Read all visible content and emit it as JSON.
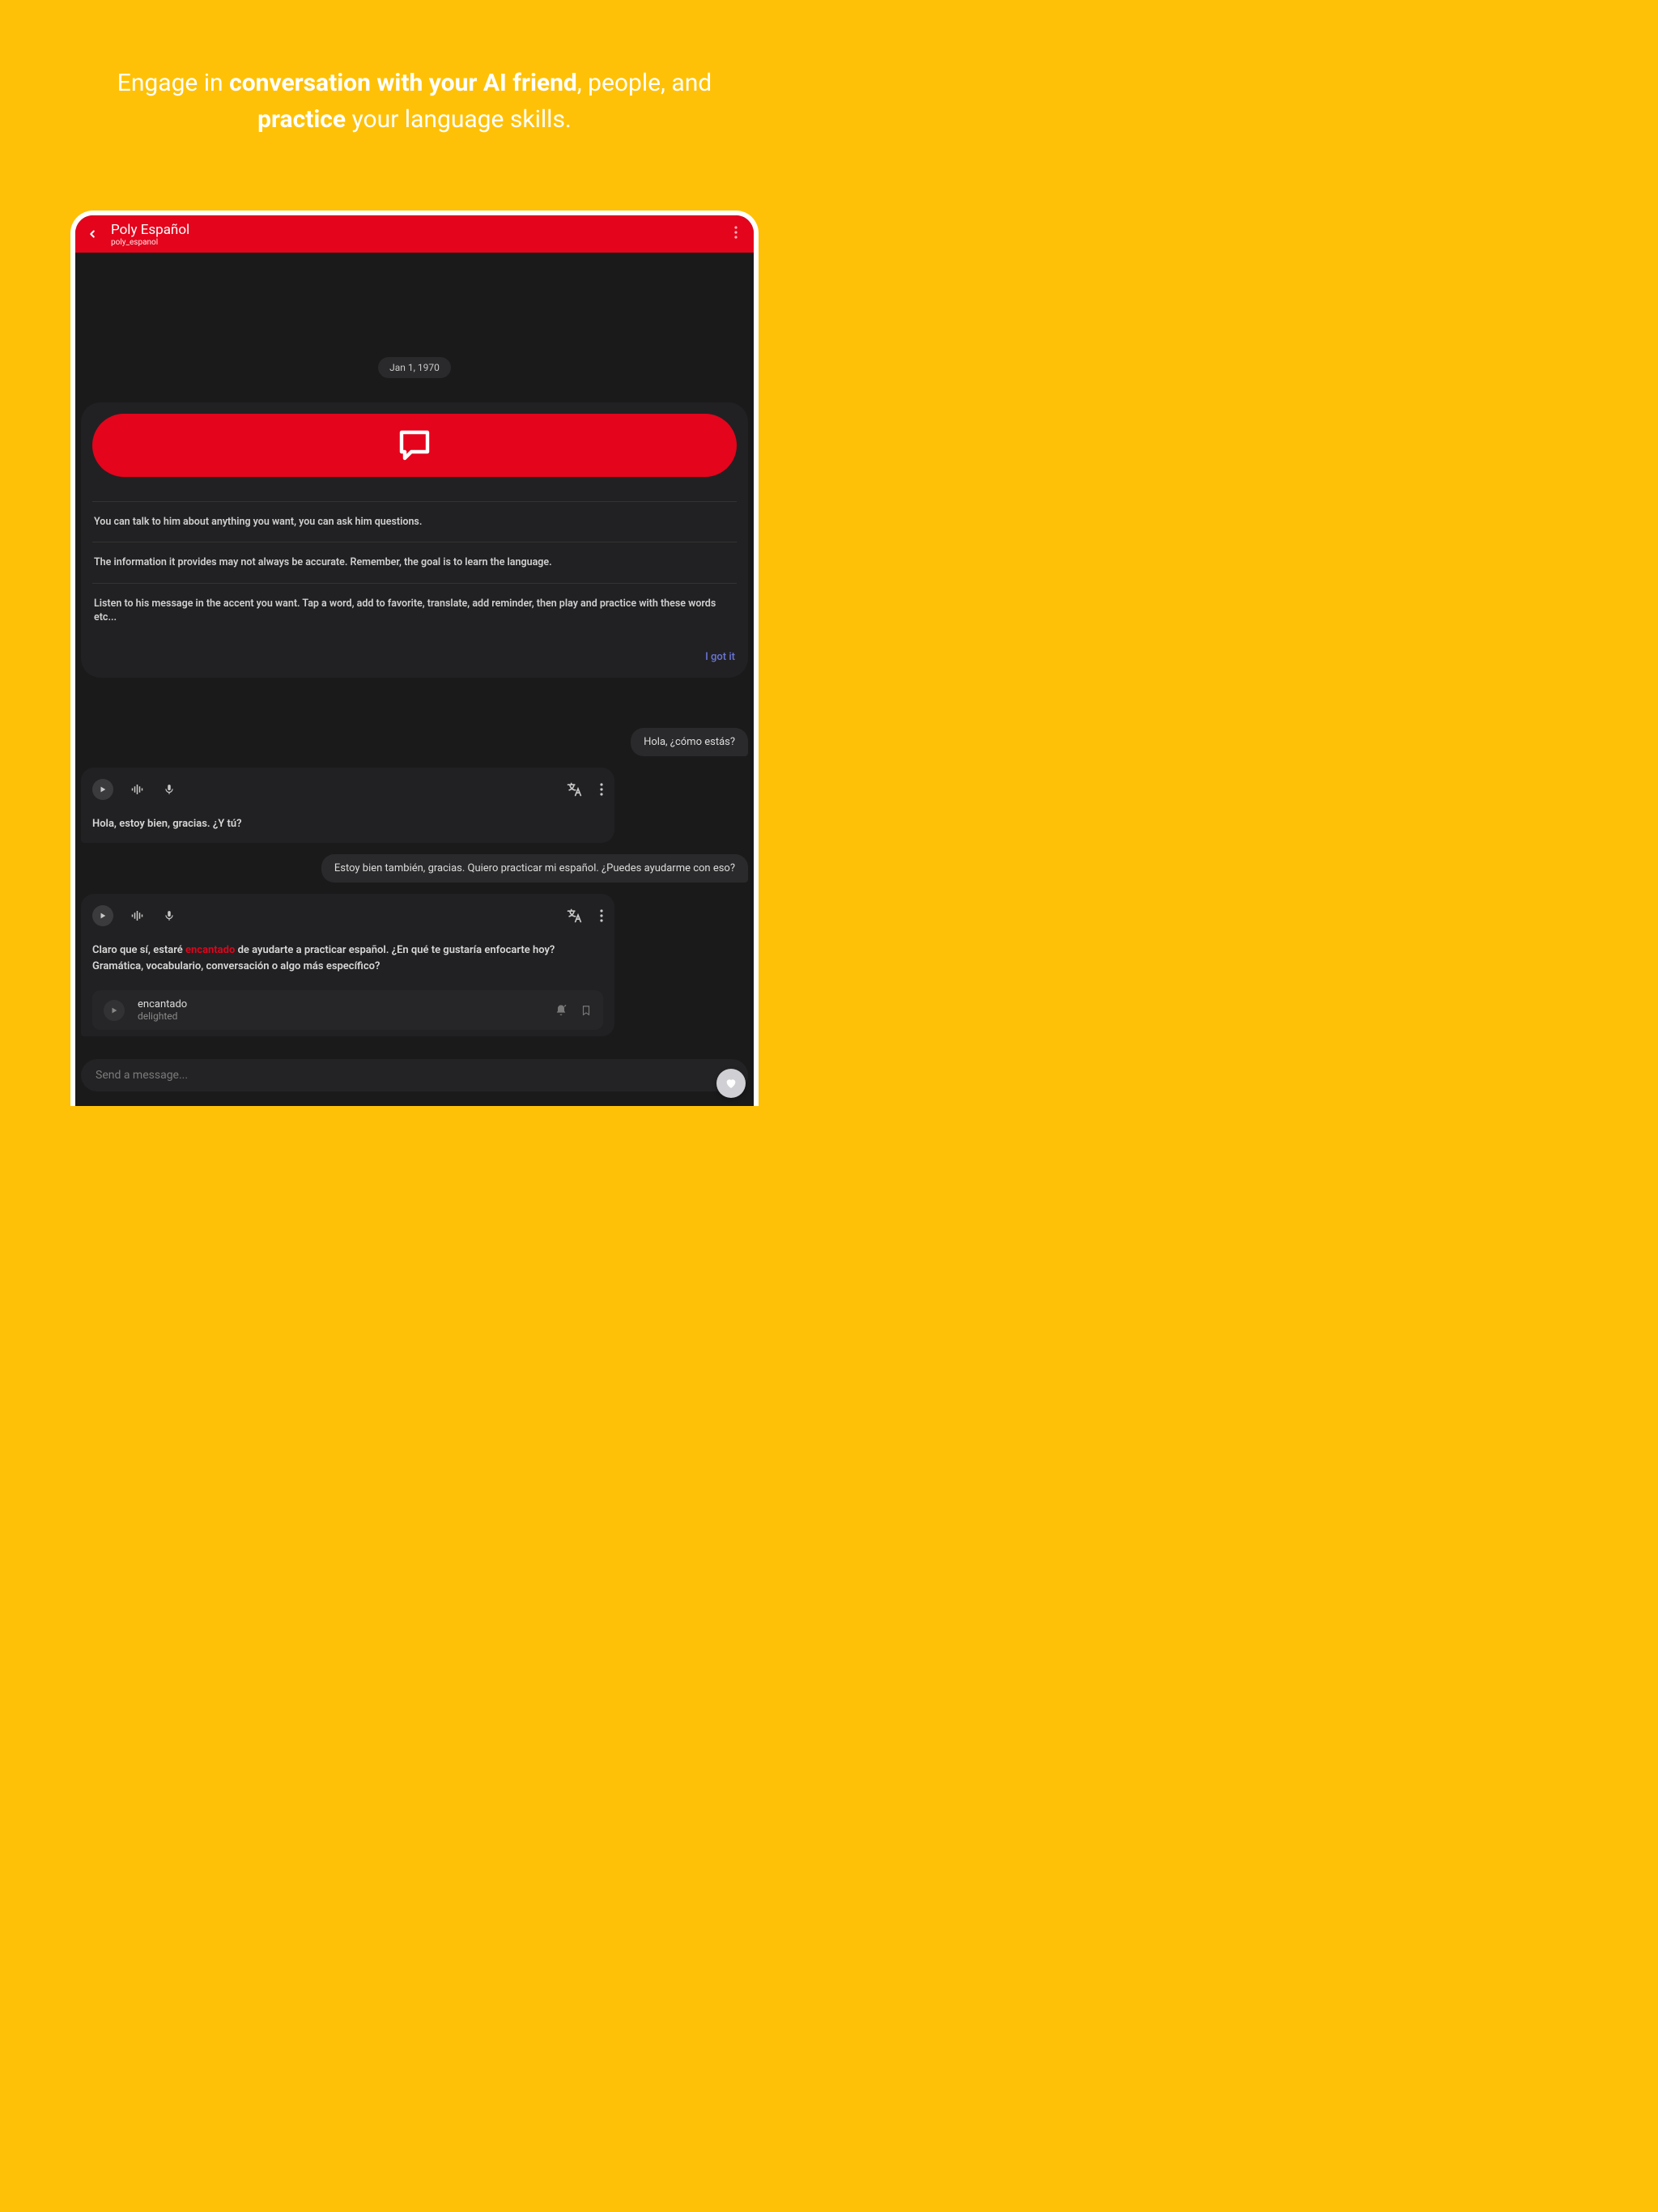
{
  "hero": {
    "pre": "Engage in ",
    "bold1": "conversation with your AI friend",
    "mid": ", people, and ",
    "bold2": "practice",
    "post": " your language skills."
  },
  "header": {
    "title": "Poly Español",
    "subtitle": "poly_espanol"
  },
  "date": "Jan 1, 1970",
  "intro": {
    "line1": "You can talk to him about anything you want, you can ask him questions.",
    "line2": "The information it provides may not always be accurate. Remember, the goal is to learn the language.",
    "line3": "Listen to his message in the accent you want. Tap a word, add to favorite, translate, add reminder, then play and practice with these words etc...",
    "gotit": "I got it"
  },
  "messages": {
    "user1": "Hola, ¿cómo estás?",
    "ai1": "Hola, estoy bien, gracias. ¿Y tú?",
    "user2": "Estoy bien también, gracias. Quiero practicar mi español. ¿Puedes ayudarme con eso?",
    "ai2_pre": "Claro que sí, estaré ",
    "ai2_hl": "encantado",
    "ai2_post": " de ayudarte a practicar español. ¿En qué te gustaría enfocarte hoy? Gramática, vocabulario, conversación o algo más específico?"
  },
  "vocab": {
    "word": "encantado",
    "translation": "delighted"
  },
  "composer": {
    "placeholder": "Send a message..."
  }
}
